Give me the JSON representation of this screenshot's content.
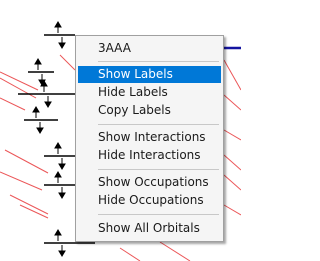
{
  "context_menu": {
    "header": "3AAA",
    "groups": [
      [
        {
          "label": "Show Labels",
          "selected": true
        },
        {
          "label": "Hide Labels",
          "selected": false
        },
        {
          "label": "Copy Labels",
          "selected": false
        }
      ],
      [
        {
          "label": "Show Interactions",
          "selected": false
        },
        {
          "label": "Hide Interactions",
          "selected": false
        }
      ],
      [
        {
          "label": "Show Occupations",
          "selected": false
        },
        {
          "label": "Hide Occupations",
          "selected": false
        }
      ],
      [
        {
          "label": "Show All Orbitals",
          "selected": false
        }
      ]
    ]
  },
  "colors": {
    "highlight": "#0078d7",
    "menu_background": "#f5f5f5",
    "interaction_line": "#e8393b",
    "orbital_level": "#000000",
    "orbital_selected": "#1414a0"
  }
}
